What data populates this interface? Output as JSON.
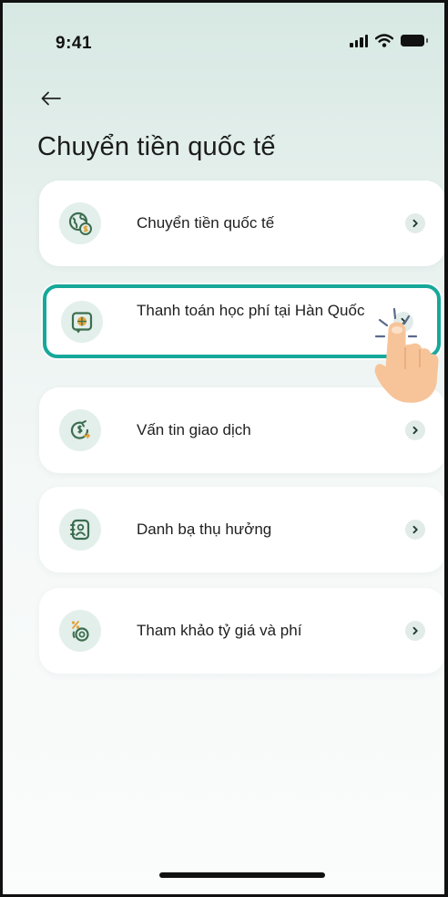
{
  "status_bar": {
    "time": "9:41"
  },
  "header": {
    "title": "Chuyển tiền quốc tế"
  },
  "menu": {
    "items": [
      {
        "label": "Chuyển tiền quốc tế",
        "icon": "globe-money-icon"
      },
      {
        "label": "Thanh toán học phí tại Hàn Quốc",
        "icon": "tuition-payment-icon"
      },
      {
        "label": "Vấn tin giao dịch",
        "icon": "transaction-inquiry-icon"
      },
      {
        "label": "Danh bạ thụ hưởng",
        "icon": "beneficiary-contacts-icon"
      },
      {
        "label": "Tham khảo tỷ giá và phí",
        "icon": "exchange-rate-fee-icon"
      }
    ]
  },
  "colors": {
    "accent": "#16a89a",
    "background_top": "#d7e8e3",
    "card": "#ffffff",
    "icon_circle": "#e3efeb",
    "icon_stroke": "#3d6e4f",
    "hand_skin": "#f7c49a"
  }
}
